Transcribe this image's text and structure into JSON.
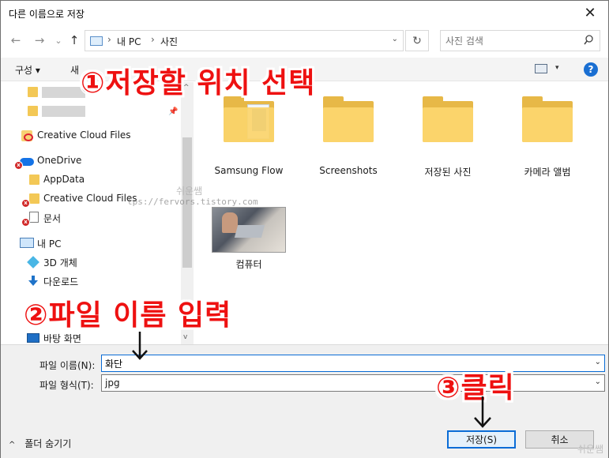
{
  "window": {
    "title": "다른 이름으로 저장",
    "close_glyph": "✕"
  },
  "nav": {
    "back_glyph": "←",
    "forward_glyph": "→",
    "recent_glyph": "⌄",
    "up_glyph": "↑"
  },
  "address": {
    "segments": [
      "내 PC",
      "사진"
    ],
    "separator": "›",
    "dropdown_glyph": "⌄",
    "refresh_glyph": "↻"
  },
  "search": {
    "placeholder": "사진 검색"
  },
  "toolbar": {
    "organize": "구성 ▾",
    "new_folder": "새",
    "view_dropdown": "▾",
    "help": "?"
  },
  "tree": {
    "creative_cloud_top": "Creative Cloud Files",
    "onedrive": "OneDrive",
    "appdata": "AppData",
    "creative_cloud_sub": "Creative Cloud Files",
    "documents": "문서",
    "this_pc": "내 PC",
    "objects_3d": "3D 개체",
    "downloads": "다운로드",
    "desktop": "바탕 화면",
    "pin_glyph": "📌",
    "error_glyph": "x",
    "scroll_up": "^",
    "scroll_down": "v"
  },
  "files": [
    {
      "name": "Samsung Flow"
    },
    {
      "name": "Screenshots"
    },
    {
      "name": "저장된 사진"
    },
    {
      "name": "카메라 앨범"
    },
    {
      "name": "컴퓨터"
    }
  ],
  "watermark": {
    "url": "tps://fervors.tistory.com",
    "name": "쉬운쌤",
    "corner": "쉬운쌤"
  },
  "form": {
    "filename_label": "파일 이름(N):",
    "filename_value": "화단",
    "filetype_label": "파일 형식(T):",
    "filetype_value": "jpg",
    "dropdown_glyph": "⌄",
    "hide_folders": "폴더 숨기기",
    "hide_chevron": "^",
    "save": "저장(S)",
    "cancel": "취소"
  },
  "annotations": {
    "step1": "①저장할 위치 선택",
    "step2": "②파일 이름 입력",
    "step3": "③클릭",
    "color": "#ee1111"
  }
}
